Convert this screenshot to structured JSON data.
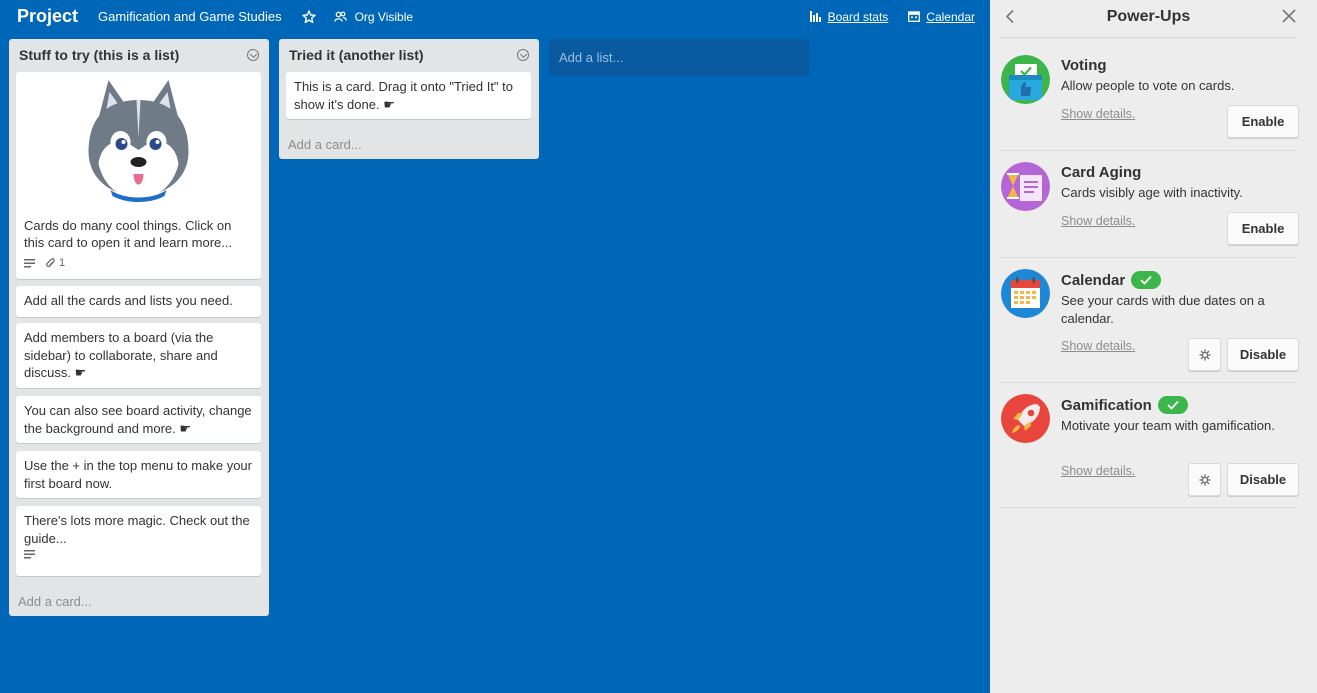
{
  "header": {
    "title": "Project",
    "org_name": "Gamification and Game Studies",
    "visibility": "Org Visible",
    "board_stats": "Board stats",
    "calendar": "Calendar"
  },
  "lists": [
    {
      "title": "Stuff to try (this is a list)",
      "cards": [
        {
          "text": "Cards do many cool things. Click on this card to open it and learn more...",
          "attachments": "1"
        },
        {
          "text": "Add all the cards and lists you need."
        },
        {
          "text": "Add members to a board (via the sidebar) to collaborate, share and discuss. ☛"
        },
        {
          "text": "You can also see board activity, change the background and more. ☛"
        },
        {
          "text": "Use the + in the top menu to make your first board now."
        },
        {
          "text": "There's lots more magic. Check out the guide..."
        }
      ],
      "add_card": "Add a card..."
    },
    {
      "title": "Tried it (another list)",
      "cards": [
        {
          "text": "This is a card. Drag it onto \"Tried It\" to show it's done. ☛"
        }
      ],
      "add_card": "Add a card..."
    }
  ],
  "add_list_placeholder": "Add a list...",
  "sidebar": {
    "title": "Power-Ups",
    "powerups": [
      {
        "name": "Voting",
        "description": "Allow people to vote on cards.",
        "show_details": "Show details.",
        "button": "Enable",
        "enabled": false,
        "icon": "voting-icon",
        "color": "#3cb54a"
      },
      {
        "name": "Card Aging",
        "description": "Cards visibly age with inactivity.",
        "show_details": "Show details.",
        "button": "Enable",
        "enabled": false,
        "icon": "card-aging-icon",
        "color": "#b566d6"
      },
      {
        "name": "Calendar",
        "description": "See your cards with due dates on a calendar.",
        "show_details": "Show details.",
        "button": "Disable",
        "enabled": true,
        "icon": "calendar-icon",
        "color": "#1e88d6"
      },
      {
        "name": "Gamification",
        "description": "Motivate your team with gamification.",
        "show_details": "Show details.",
        "button": "Disable",
        "enabled": true,
        "icon": "rocket-icon",
        "color": "#e8463c"
      }
    ]
  },
  "colors": {
    "board_background": "#0067b8",
    "list_background": "#e2e4e6",
    "enabled_badge": "#3cb54a"
  }
}
